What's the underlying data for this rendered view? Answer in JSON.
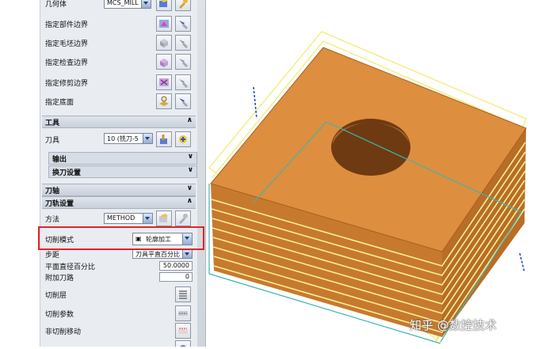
{
  "geometry": {
    "rows": [
      {
        "label": "几何体",
        "combo": "MCS_MILL"
      },
      {
        "label": "指定部件边界"
      },
      {
        "label": "指定毛坯边界"
      },
      {
        "label": "指定检查边界"
      },
      {
        "label": "指定修剪边界"
      },
      {
        "label": "指定底面"
      }
    ]
  },
  "tool": {
    "section": "工具",
    "tool_label": "刀具",
    "tool_value": "10 (铣刀-5",
    "sub1": "输出",
    "sub2": "换刀设置"
  },
  "axis": {
    "section": "刀轴"
  },
  "path": {
    "section": "刀轨设置",
    "method_label": "方法",
    "method_value": "METHOD",
    "cut_mode_label": "切削模式",
    "cut_mode_value": "轮廓加工",
    "stepover_label": "步距",
    "stepover_value": "刀具平直百分比",
    "percent_label": "平面直径百分比",
    "percent_value": "50.0000",
    "extra_label": "附加刀路",
    "extra_value": "0",
    "levels_label": "切削层",
    "params_label": "切削参数",
    "noncut_label": "非切削移动"
  },
  "watermark": "知乎 @数控技术",
  "colors": {
    "highlight": "#e0242a",
    "part": "#d98a3c",
    "toolpath": "#f2ea6a",
    "boundary": "#3fb4b0"
  }
}
